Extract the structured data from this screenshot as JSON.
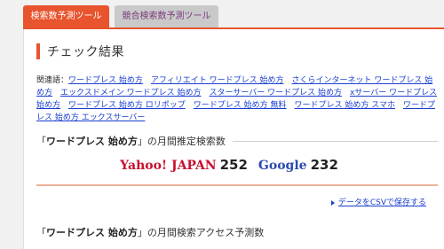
{
  "tabs": [
    {
      "label": "検索数予測ツール",
      "active": true
    },
    {
      "label": "競合検索数予測ツール",
      "active": false
    }
  ],
  "section": {
    "title": "チェック結果"
  },
  "related": {
    "prefix": "関連語：",
    "links": [
      "ワードプレス 始め方",
      "アフィリエイト ワードプレス 始め方",
      "さくらインターネット ワードプレス 始め方",
      "エックスドメイン ワードプレス 始め方",
      "スターサーバー ワードプレス 始め方",
      "xサーバー ワードプレス 始め方",
      "ワードプレス 始め方 ロリポップ",
      "ワードプレス 始め方 無料",
      "ワードプレス 始め方 スマホ",
      "ワードプレス 始め方 エックスサーバー"
    ]
  },
  "volume_section": {
    "open_quote": "「",
    "keyword": "ワードプレス 始め方",
    "close_quote": "」",
    "suffix": "の月間推定検索数"
  },
  "volumes": {
    "yahoo_label": "Yahoo! JAPAN",
    "yahoo_value": "252",
    "google_label": "Google",
    "google_value": "232"
  },
  "csv_link": "データをCSVで保存する",
  "access_section": {
    "open_quote": "「",
    "keyword": "ワードプレス 始め方",
    "close_quote": "」",
    "suffix": "の月間検索アクセス予測数"
  },
  "colors": {
    "accent": "#e8542e",
    "link": "#1a3fd0",
    "yahoo": "#c8102e",
    "google": "#2a4ab0"
  }
}
